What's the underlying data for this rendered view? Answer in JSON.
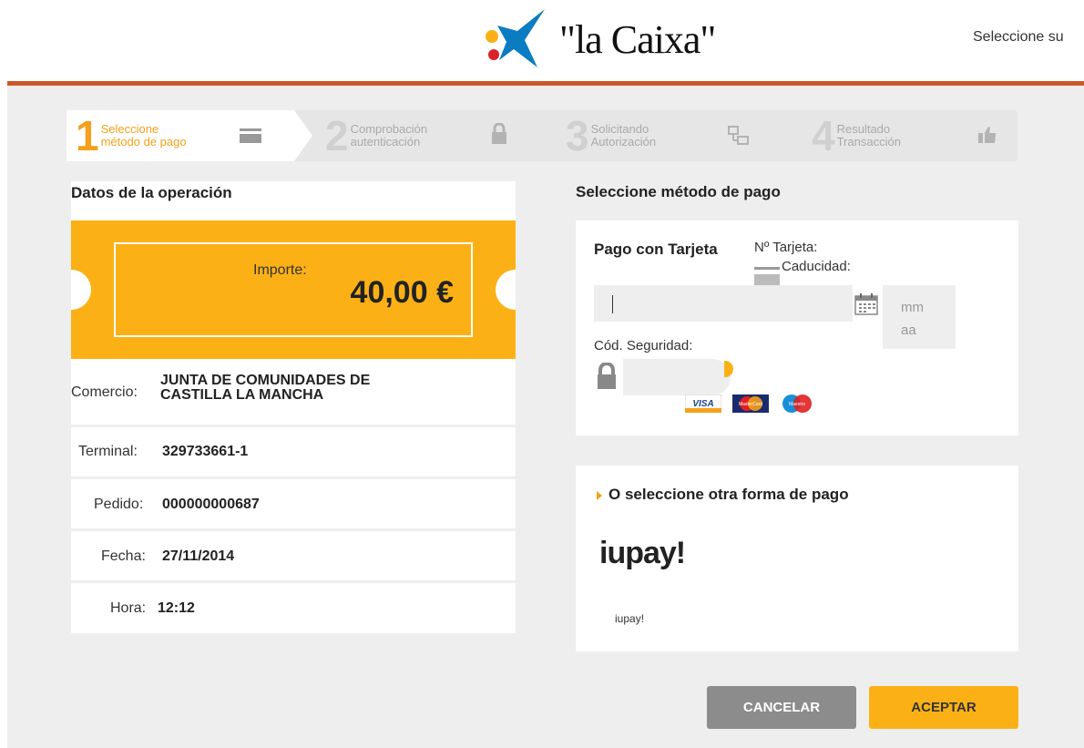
{
  "header": {
    "logo_text": "\"la Caixa\"",
    "lang_text": "Seleccione su"
  },
  "steps": [
    {
      "num": "1",
      "line1": "Seleccione",
      "line2": "método de pago",
      "icon": "card-icon"
    },
    {
      "num": "2",
      "line1": "Comprobación",
      "line2": "autenticación",
      "icon": "lock-icon"
    },
    {
      "num": "3",
      "line1": "Solicitando",
      "line2": "Autorización",
      "icon": "network-icon"
    },
    {
      "num": "4",
      "line1": "Resultado",
      "line2": "Transacción",
      "icon": "thumbs-up-icon"
    }
  ],
  "left": {
    "title": "Datos de la operación",
    "importe_label": "Importe:",
    "importe_value": "40,00 €",
    "comercio_label": "Comercio:",
    "comercio_line1": "JUNTA DE COMUNIDADES DE",
    "comercio_line2": "CASTILLA LA MANCHA",
    "terminal_label": "Terminal:",
    "terminal_value": "329733661-1",
    "pedido_label": "Pedido:",
    "pedido_value": "000000000687",
    "fecha_label": "Fecha:",
    "fecha_value": "27/11/2014",
    "hora_label": "Hora:",
    "hora_value": "12:12"
  },
  "right": {
    "title": "Seleccione método de pago",
    "pago_tarjeta": "Pago con Tarjeta",
    "num_tarjeta_label": "Nº Tarjeta:",
    "caducidad_label": "Caducidad:",
    "mm_placeholder": "mm",
    "aa_placeholder": "aa",
    "cod_seguridad_label": "Cód. Seguridad:",
    "card_brands": [
      "VISA",
      "MasterCard",
      "Maestro"
    ],
    "other_title": "O seleccione otra forma de pago",
    "iupay_logo": "iupay!",
    "iupay_label": "iupay!"
  },
  "buttons": {
    "cancel": "CANCELAR",
    "accept": "ACEPTAR"
  },
  "colors": {
    "accent": "#fbb116",
    "brand_bar": "#c9592b",
    "cancel_button": "#8c8c8c"
  }
}
